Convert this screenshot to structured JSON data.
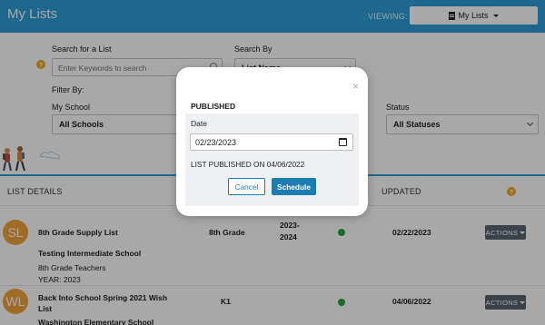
{
  "header": {
    "title": "My Lists",
    "viewing_label": "VIEWING:",
    "view_button": "My Lists"
  },
  "filters": {
    "search_label": "Search for a List",
    "search_placeholder": "Enter Keywords to search",
    "search_by_label": "Search By",
    "search_by_value": "List Name",
    "filter_by_label": "Filter By:",
    "school_label": "My School",
    "school_value": "All Schools",
    "status_label": "Status",
    "status_value": "All Statuses"
  },
  "table": {
    "headers": {
      "details": "LIST DETAILS",
      "updated": "UPDATED"
    },
    "rows": [
      {
        "initials": "SL",
        "name": "8th Grade Supply List",
        "school": "Testing Intermediate School",
        "teacher": "8th Grade Teachers",
        "year": "YEAR: 2023",
        "grade": "8th Grade",
        "year_span": "2023-2024",
        "year_span_line1": "2023-",
        "year_span_line2": "2024",
        "updated": "02/22/2023",
        "actions": "ACTIONS"
      },
      {
        "initials": "WL",
        "name_line1": "Back Into School Spring 2021 Wish",
        "name_line2": "List",
        "school": "Washington Elementary School",
        "grade": "K1",
        "updated": "04/06/2022",
        "actions": "ACTIONS"
      }
    ]
  },
  "modal": {
    "title": "PUBLISHED",
    "close": "×",
    "date_label": "Date",
    "date_value": "02/23/2023",
    "published_text": "LIST PUBLISHED ON 04/06/2022",
    "cancel": "Cancel",
    "schedule": "Schedule"
  },
  "colors": {
    "header": "#2f9fd7",
    "primary_button": "#1b7eb3",
    "avatar": "#f0a43a",
    "status_dot": "#2aa33f",
    "help_icon": "#f5a623"
  }
}
